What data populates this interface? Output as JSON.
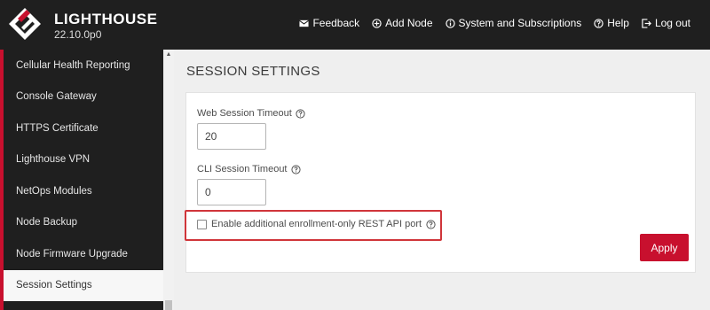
{
  "header": {
    "brand_name": "LIGHTHOUSE",
    "version": "22.10.0p0",
    "nav": [
      {
        "label": "Feedback",
        "icon": "envelope-icon"
      },
      {
        "label": "Add Node",
        "icon": "plus-circle-icon"
      },
      {
        "label": "System and Subscriptions",
        "icon": "info-circle-icon"
      },
      {
        "label": "Help",
        "icon": "question-circle-icon"
      },
      {
        "label": "Log out",
        "icon": "logout-icon"
      }
    ]
  },
  "sidebar": {
    "items": [
      {
        "label": "Cellular Health Reporting"
      },
      {
        "label": "Console Gateway"
      },
      {
        "label": "HTTPS Certificate"
      },
      {
        "label": "Lighthouse VPN"
      },
      {
        "label": "NetOps Modules"
      },
      {
        "label": "Node Backup"
      },
      {
        "label": "Node Firmware Upgrade"
      },
      {
        "label": "Session Settings",
        "active": true
      }
    ]
  },
  "main": {
    "title": "SESSION SETTINGS",
    "web_timeout": {
      "label": "Web Session Timeout",
      "value": "20"
    },
    "cli_timeout": {
      "label": "CLI Session Timeout",
      "value": "0"
    },
    "enrollment_checkbox": {
      "label": "Enable additional enrollment-only REST API port",
      "checked": false
    },
    "apply_label": "Apply"
  },
  "colors": {
    "accent": "#c8102e",
    "header_bg": "#1f1f1f",
    "highlight": "#d0353a"
  }
}
